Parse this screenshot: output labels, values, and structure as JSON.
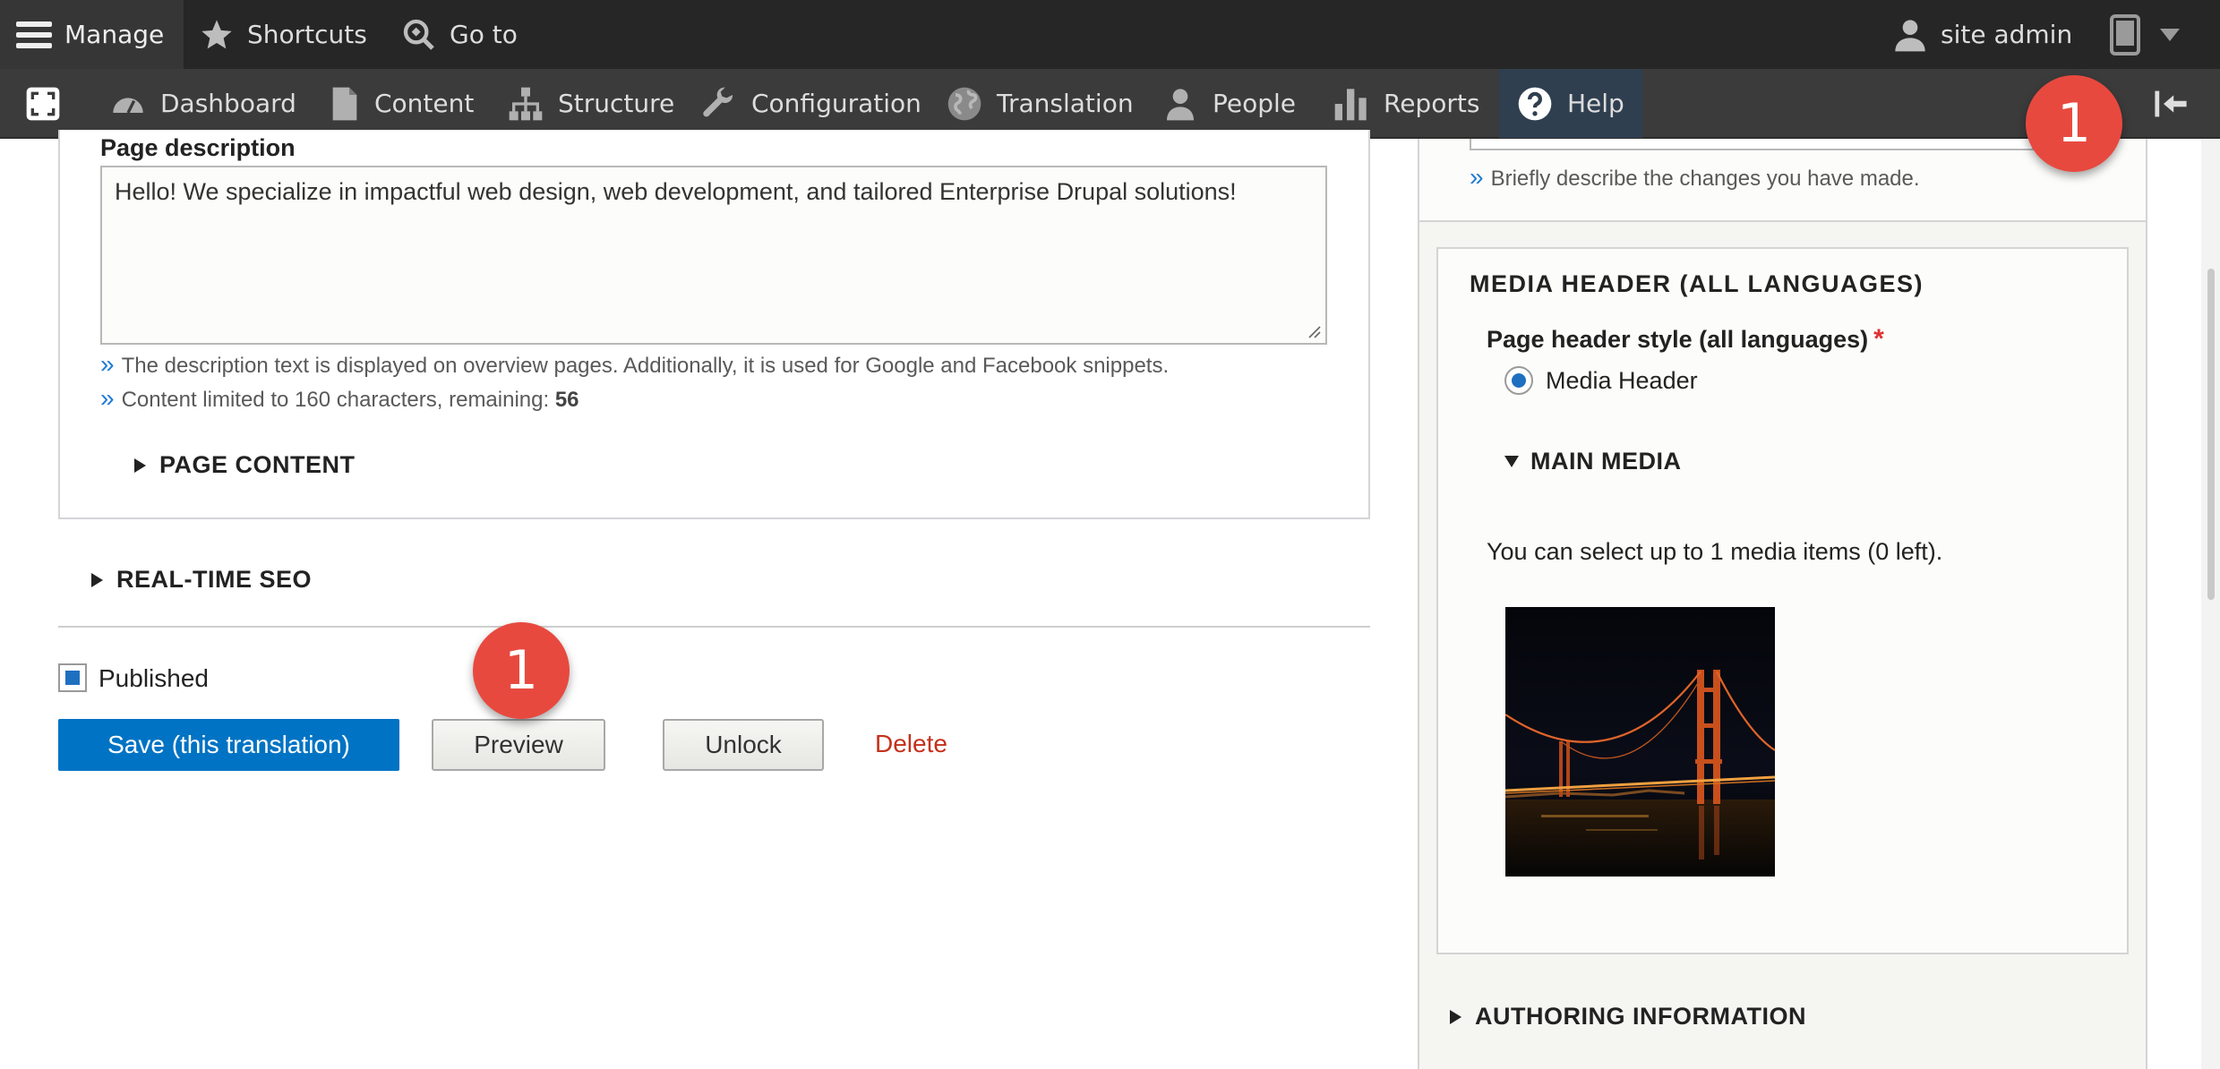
{
  "toolbar": {
    "manage": "Manage",
    "shortcuts": "Shortcuts",
    "goto": "Go to",
    "user": "site admin"
  },
  "tray": {
    "items": [
      {
        "label": "Dashboard",
        "icon": "dashboard-icon"
      },
      {
        "label": "Content",
        "icon": "page-icon"
      },
      {
        "label": "Structure",
        "icon": "sitemap-icon"
      },
      {
        "label": "Configuration",
        "icon": "wrench-icon"
      },
      {
        "label": "Translation",
        "icon": "globe-icon"
      },
      {
        "label": "People",
        "icon": "person-icon"
      },
      {
        "label": "Reports",
        "icon": "bar-chart-icon"
      },
      {
        "label": "Help",
        "icon": "question-icon"
      }
    ],
    "active_item": "Help"
  },
  "badges": {
    "toolbar_badge": "1",
    "preview_badge": "1"
  },
  "form": {
    "page_description_label": "Page description",
    "page_description_value": "Hello! We specialize in impactful web design, web development, and tailored Enterprise Drupal solutions!",
    "desc_help_1": "The description text is displayed on overview pages. Additionally, it is used for Google and Facebook snippets.",
    "desc_help_2_prefix": "Content limited to 160 characters, remaining:",
    "desc_help_2_count": "56",
    "page_content_toggle": "PAGE CONTENT",
    "realtime_seo_toggle": "REAL-TIME SEO",
    "published_label": "Published",
    "published_checked": true,
    "save_button": "Save (this translation)",
    "preview_button": "Preview",
    "unlock_button": "Unlock",
    "delete_link": "Delete",
    "raquo": "»"
  },
  "sidebar": {
    "revision_help": "Briefly describe the changes you have made.",
    "media_header_title": "MEDIA HEADER (ALL LANGUAGES)",
    "page_header_style_label": "Page header style (all languages)",
    "required_mark": "*",
    "media_header_option": "Media Header",
    "media_header_selected": true,
    "main_media_toggle": "MAIN MEDIA",
    "media_limit_note": "You can select up to 1 media items (0 left).",
    "authoring_info_toggle": "AUTHORING INFORMATION"
  },
  "colors": {
    "primary_button": "#0073c4",
    "delete_link": "#c4311c",
    "badge": "#e8493f",
    "link_quote": "#1e7bd3"
  }
}
